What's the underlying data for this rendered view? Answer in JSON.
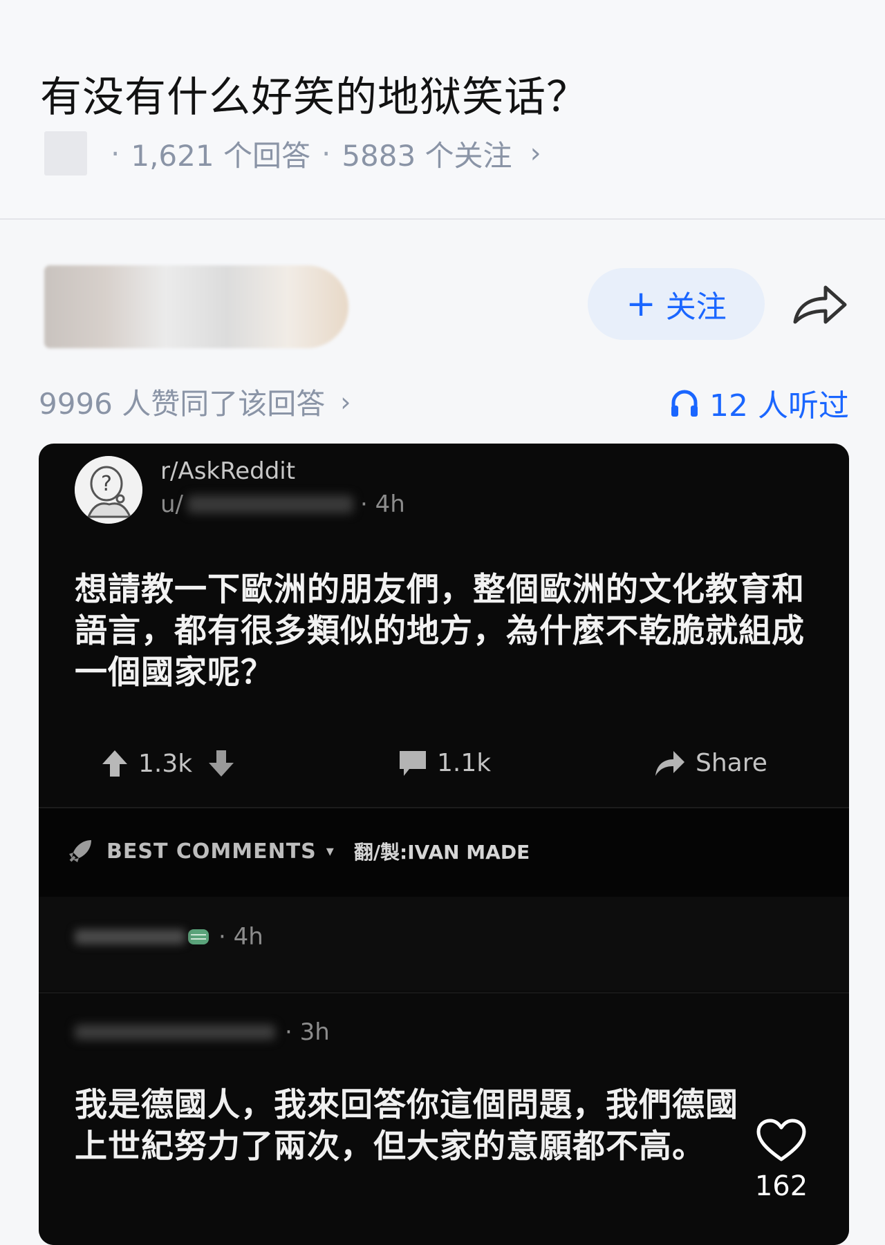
{
  "question": {
    "title": "有没有什么好笑的地狱笑话？",
    "answers_count": "1,621 个回答",
    "follow_count": "5883 个关注",
    "separator": "·",
    "chevron": "›"
  },
  "author": {
    "follow_plus": "+",
    "follow_label": "关注"
  },
  "stats": {
    "agree_text": "9996 人赞同了该回答",
    "agree_chevron": "›",
    "listen_text": "12 人听过"
  },
  "reddit_post": {
    "subreddit": "r/AskReddit",
    "user_prefix": "u/",
    "time": "· 4h",
    "body": "想請教一下歐洲的朋友們，整個歐洲的文化教育和語言，都有很多類似的地方，為什麼不乾脆就組成一個國家呢？",
    "upvotes": "1.3k",
    "comments": "1.1k",
    "share_label": "Share"
  },
  "best_comments": {
    "label": "BEST COMMENTS",
    "caret": "▾",
    "credit": "翻/製:IVAN MADE"
  },
  "comment1": {
    "time": "· 4h"
  },
  "comment2": {
    "time": "· 3h",
    "body": "我是德國人，我來回答你這個問題，我們德國上世紀努力了兩次，但大家的意願都不高。"
  },
  "like": {
    "count": "162"
  }
}
